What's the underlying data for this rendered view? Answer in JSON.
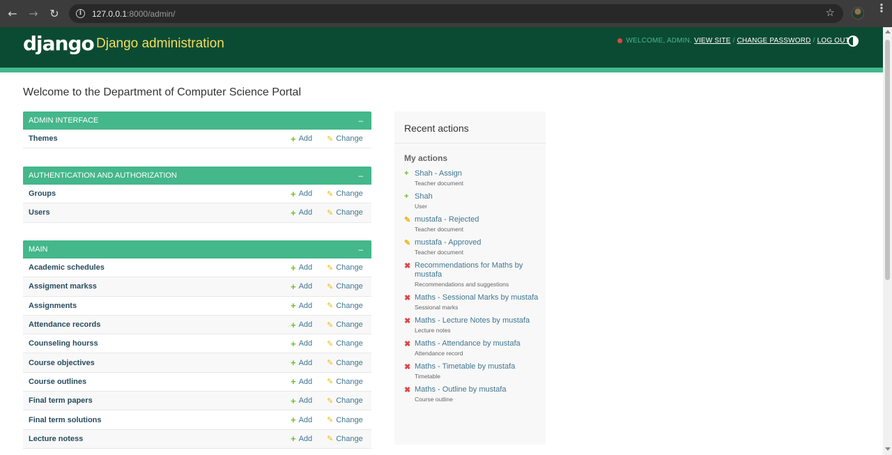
{
  "browser": {
    "url_host": "127.0.0.1",
    "url_rest": ":8000/admin/"
  },
  "header": {
    "logo": "django",
    "site_title": "Django administration",
    "welcome": "WELCOME, ADMIN.",
    "view_site": "VIEW SITE",
    "change_password": "CHANGE PASSWORD",
    "log_out": "LOG OUT",
    "separator": "/"
  },
  "page_title": "Welcome to the Department of Computer Science Portal",
  "labels": {
    "add": "Add",
    "change": "Change",
    "collapse": "–"
  },
  "modules": [
    {
      "caption": "ADMIN INTERFACE",
      "models": [
        "Themes"
      ]
    },
    {
      "caption": "AUTHENTICATION AND AUTHORIZATION",
      "models": [
        "Groups",
        "Users"
      ]
    },
    {
      "caption": "MAIN",
      "models": [
        "Academic schedules",
        "Assigment markss",
        "Assignments",
        "Attendance records",
        "Counseling hourss",
        "Course objectives",
        "Course outlines",
        "Final term papers",
        "Final term solutions",
        "Lecture notess"
      ]
    }
  ],
  "recent_actions": {
    "title": "Recent actions",
    "subtitle": "My actions",
    "items": [
      {
        "kind": "add",
        "title": "Shah - Assign",
        "ctype": "Teacher document"
      },
      {
        "kind": "add",
        "title": "Shah",
        "ctype": "User"
      },
      {
        "kind": "change",
        "title": "mustafa - Rejected",
        "ctype": "Teacher document"
      },
      {
        "kind": "change",
        "title": "mustafa - Approved",
        "ctype": "Teacher document"
      },
      {
        "kind": "delete",
        "title": "Recommendations for Maths by mustafa",
        "ctype": "Recommendations and suggestions"
      },
      {
        "kind": "delete",
        "title": "Maths - Sessional Marks by mustafa",
        "ctype": "Sessional marks"
      },
      {
        "kind": "delete",
        "title": "Maths - Lecture Notes by mustafa",
        "ctype": "Lecture notes"
      },
      {
        "kind": "delete",
        "title": "Maths - Attendance by mustafa",
        "ctype": "Attendance record"
      },
      {
        "kind": "delete",
        "title": "Maths - Timetable by mustafa",
        "ctype": "Timetable"
      },
      {
        "kind": "delete",
        "title": "Maths - Outline by mustafa",
        "ctype": "Course outline"
      }
    ]
  },
  "colors": {
    "header_bg": "#0c4b33",
    "accent": "#44b78b",
    "title_yellow": "#f5dd5d",
    "add_green": "#70bf2b",
    "change_yellow": "#efb80b",
    "delete_red": "#dd4646"
  }
}
